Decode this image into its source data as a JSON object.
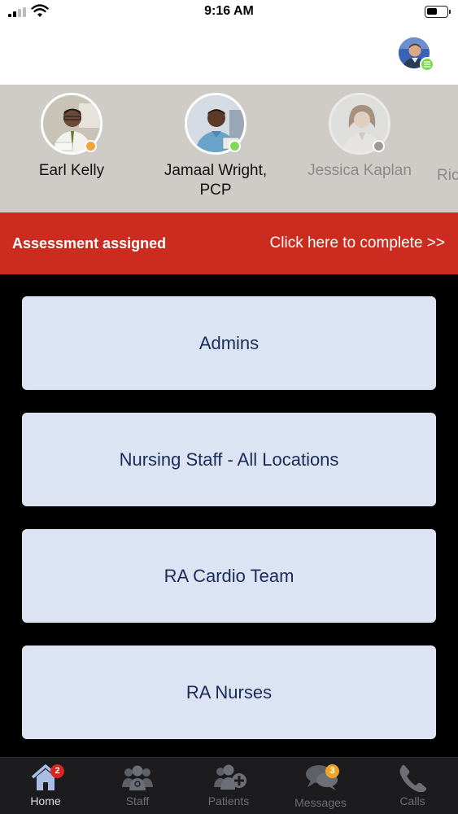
{
  "status_bar": {
    "time": "9:16 AM",
    "battery_level": 0.55
  },
  "header": {
    "profile_icon": "user-avatar",
    "profile_status_color": "#7ed957"
  },
  "staff": [
    {
      "name": "Earl Kelly",
      "status_color": "#f2a33a"
    },
    {
      "name": "Jamaal Wright, PCP",
      "status_color": "#7ed957"
    },
    {
      "name": "Jessica Kaplan",
      "status_color": "#9b9b9b"
    },
    {
      "name": "Ric"
    }
  ],
  "banner": {
    "title": "Assessment assigned",
    "link": "Click here to complete >>",
    "color": "#cc2b1f"
  },
  "groups": [
    {
      "label": "Admins"
    },
    {
      "label": "Nursing Staff - All Locations"
    },
    {
      "label": "RA Cardio Team"
    },
    {
      "label": "RA Nurses"
    }
  ],
  "tabs": [
    {
      "label": "Home",
      "icon": "home-icon",
      "badge": "2",
      "active": true
    },
    {
      "label": "Staff",
      "icon": "staff-icon"
    },
    {
      "label": "Patients",
      "icon": "patients-icon"
    },
    {
      "label": "Messages",
      "icon": "messages-icon",
      "badge": "3"
    },
    {
      "label": "Calls",
      "icon": "phone-icon"
    }
  ]
}
